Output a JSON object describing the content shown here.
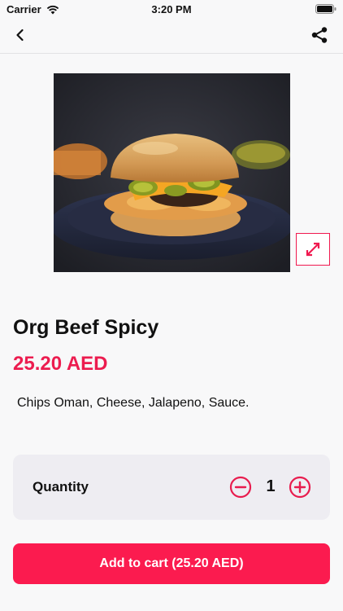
{
  "status_bar": {
    "carrier": "Carrier",
    "time": "3:20 PM"
  },
  "nav": {
    "back_icon": "chevron-left-icon",
    "share_icon": "share-icon"
  },
  "product": {
    "image_description_icon": "food-photo",
    "name": "Org Beef Spicy",
    "price": "25.20 AED",
    "description": "Chips Oman, Cheese, Jalapeno, Sauce."
  },
  "quantity": {
    "label": "Quantity",
    "value": "1"
  },
  "cart_button": {
    "label": "Add to cart (25.20 AED)"
  },
  "colors": {
    "accent": "#fb1b4f",
    "price": "#ec1c4f",
    "background": "#f8f8f9",
    "card": "#eeedf2"
  }
}
